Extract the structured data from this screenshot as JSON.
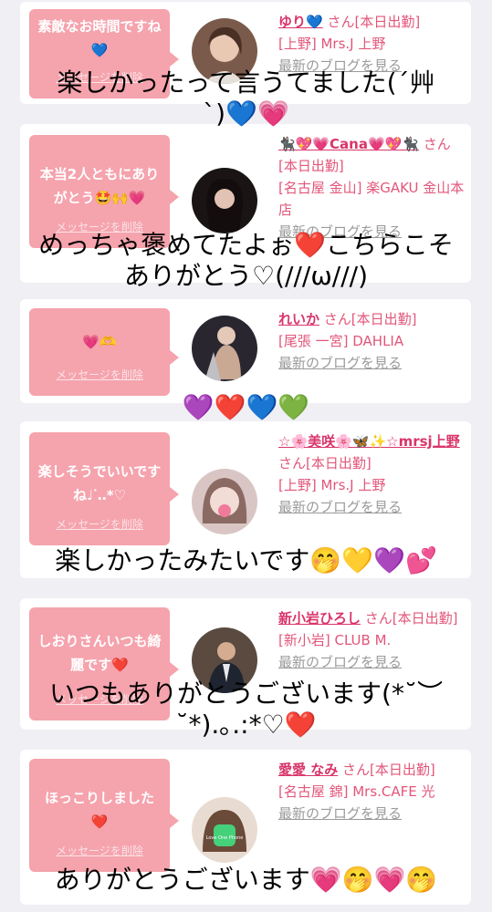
{
  "cards": [
    {
      "message": "素敵なお時間ですね💙",
      "delete_label": "メッセージを削除",
      "name": "ゆり💙",
      "san": "さん[本日出勤]",
      "shop": "[上野] Mrs.J 上野",
      "blog": "最新のブログを見る"
    },
    {
      "message": "本当2人ともにありがとう🤩🙌💗",
      "delete_label": "メッセージを削除",
      "name": "🐈‍⬛💖💗Cana💗💖🐈‍⬛",
      "san": "さん[本日出勤]",
      "shop": "[名古屋 金山] 楽GAKU 金山本店",
      "blog": "最新のブログを見る"
    },
    {
      "message": "💗🫶",
      "delete_label": "メッセージを削除",
      "name": "れいか",
      "san": "さん[本日出勤]",
      "shop": "[尾張 一宮] DAHLIA",
      "blog": "最新のブログを見る"
    },
    {
      "message": "楽しそうでいいですね♩ᐝ‥*♡",
      "delete_label": "メッセージを削除",
      "name": "☆🌸美咲🌸🦋✨☆mrsj上野",
      "san": "さん[本日出勤]",
      "shop": "[上野] Mrs.J 上野",
      "blog": "最新のブログを見る"
    },
    {
      "message": "しおりさんいつも綺麗です❤️",
      "delete_label": "メッセージを削除",
      "name": "新小岩ひろし",
      "san": "さん[本日出勤]",
      "shop": "[新小岩] CLUB M.",
      "blog": "最新のブログを見る"
    },
    {
      "message": "ほっこりしました❤️",
      "delete_label": "メッセージを削除",
      "name": "愛愛 なみ",
      "san": "さん[本日出勤]",
      "shop": "[名古屋 錦] Mrs.CAFE 光",
      "blog": "最新のブログを見る"
    }
  ],
  "overlays": {
    "o1_line1": "楽しかったって言うてました(´艸",
    "o1_line2": "`)💙💗",
    "o2_line1": "めっちゃ褒めてたよぉ❤️こちらこそ",
    "o2_line2": "ありがとう♡(///ω///)",
    "o3": "💜❤️💙💚",
    "o4": "楽しかったみたいです🤭💛💜💕",
    "o5_line1": "いつもありがとうございます(*˘︶",
    "o5_line2": "˘*).｡.:*♡❤️",
    "o6": "ありがとうございます💗🤭💗🤭"
  },
  "avatar_badge": "Love One Phone"
}
